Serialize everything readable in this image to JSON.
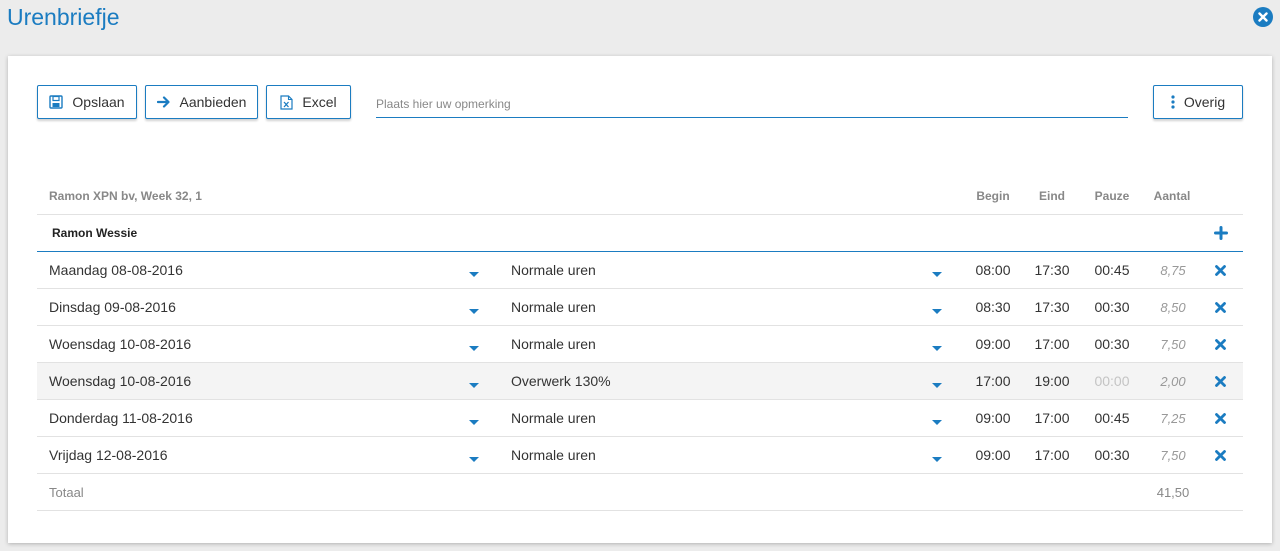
{
  "header": {
    "title": "Urenbriefje"
  },
  "toolbar": {
    "save_label": "Opslaan",
    "offer_label": "Aanbieden",
    "excel_label": "Excel",
    "remark_placeholder": "Plaats hier uw opmerking",
    "more_label": "Overig"
  },
  "table": {
    "caption": "Ramon XPN bv, Week 32, 1",
    "columns": {
      "begin": "Begin",
      "end": "Eind",
      "pause": "Pauze",
      "amount": "Aantal"
    },
    "employee": "Ramon Wessie",
    "rows": [
      {
        "day": "Maandag 08-08-2016",
        "type": "Normale uren",
        "begin": "08:00",
        "end": "17:30",
        "pause": "00:45",
        "amount": "8,75"
      },
      {
        "day": "Dinsdag 09-08-2016",
        "type": "Normale uren",
        "begin": "08:30",
        "end": "17:30",
        "pause": "00:30",
        "amount": "8,50"
      },
      {
        "day": "Woensdag 10-08-2016",
        "type": "Normale uren",
        "begin": "09:00",
        "end": "17:00",
        "pause": "00:30",
        "amount": "7,50"
      },
      {
        "day": "Woensdag 10-08-2016",
        "type": "Overwerk 130%",
        "begin": "17:00",
        "end": "19:00",
        "pause": "00:00",
        "amount": "2,00"
      },
      {
        "day": "Donderdag 11-08-2016",
        "type": "Normale uren",
        "begin": "09:00",
        "end": "17:00",
        "pause": "00:45",
        "amount": "7,25"
      },
      {
        "day": "Vrijdag 12-08-2016",
        "type": "Normale uren",
        "begin": "09:00",
        "end": "17:00",
        "pause": "00:30",
        "amount": "7,50"
      }
    ],
    "total_label": "Totaal",
    "total_value": "41,50"
  },
  "colors": {
    "accent": "#1b7cc1",
    "highlight_row": "#f4f4f4"
  }
}
